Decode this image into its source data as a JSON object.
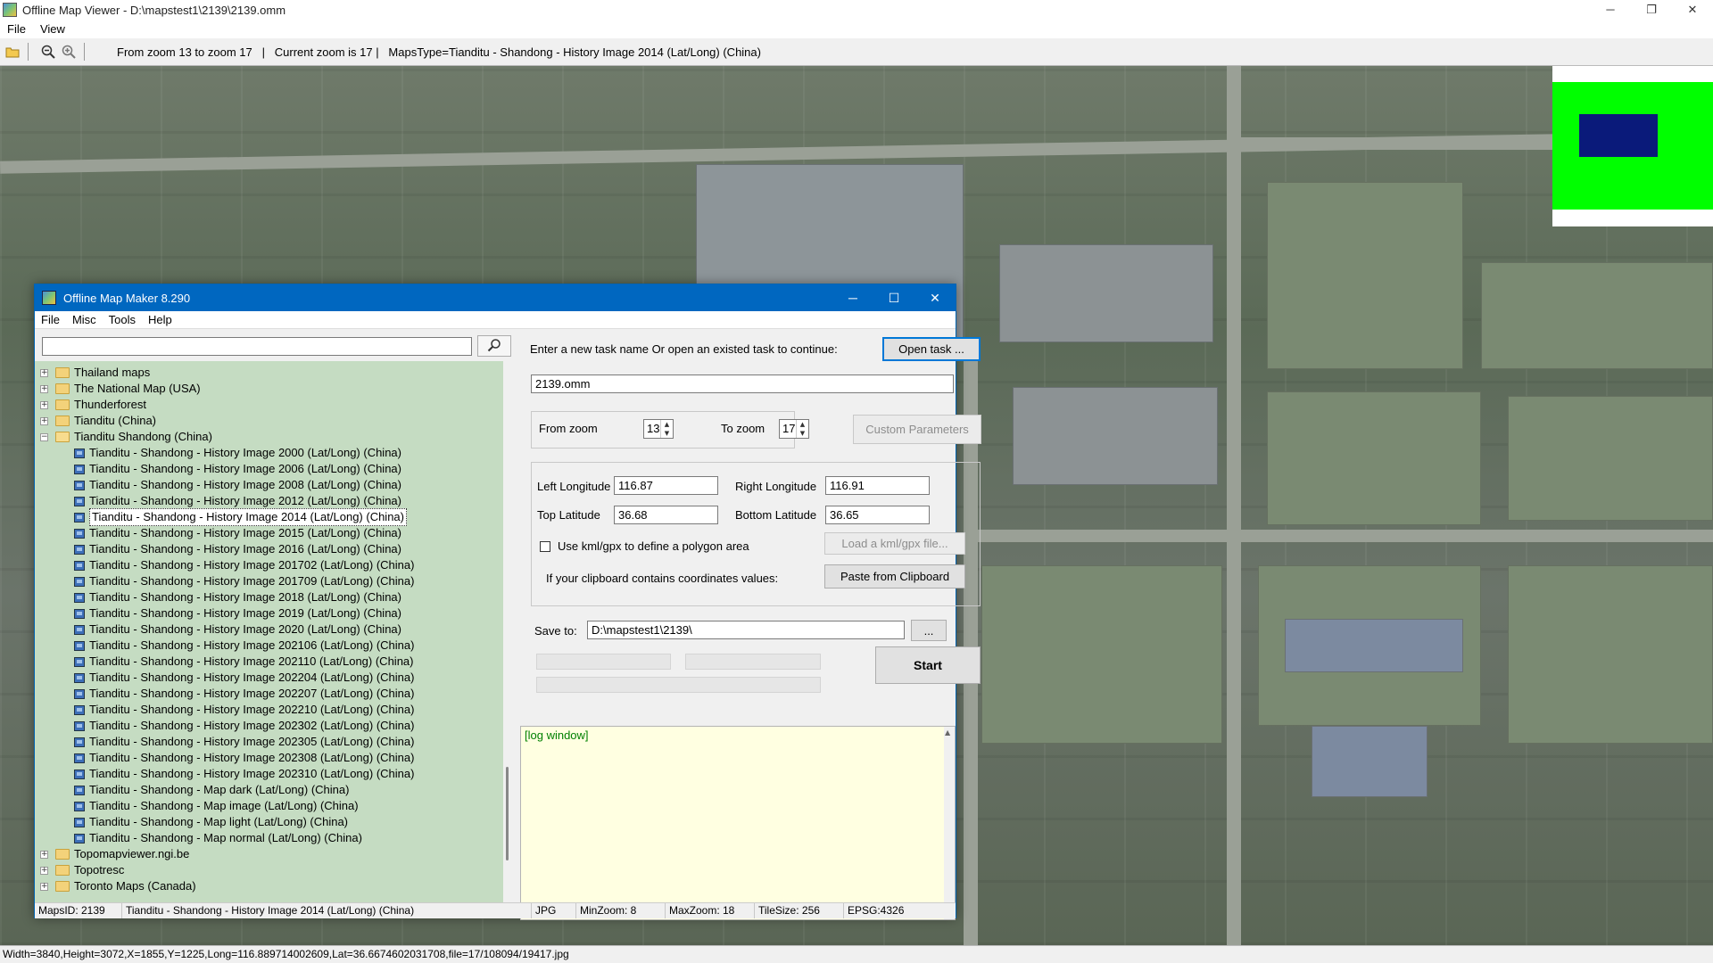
{
  "window": {
    "title": "Offline Map Viewer - D:\\mapstest1\\2139\\2139.omm",
    "controls": {
      "minimize": "─",
      "maximize": "❐",
      "close": "✕"
    }
  },
  "menu": {
    "items": [
      "File",
      "View"
    ]
  },
  "toolbar": {
    "info": "From zoom 13 to zoom 17   |   Current zoom is 17 |   MapsType=Tianditu - Shandong - History Image 2014 (Lat/Long) (China)"
  },
  "statusbar": {
    "text": "Width=3840,Height=3072,X=1855,Y=1225,Long=116.889714002609,Lat=36.6674602031708,file=17/108094/19417.jpg"
  },
  "dialog": {
    "title": "Offline Map Maker 8.290",
    "controls": {
      "minimize": "─",
      "maximize": "☐",
      "close": "✕"
    },
    "menu": [
      "File",
      "Misc",
      "Tools",
      "Help"
    ],
    "search": {
      "value": "",
      "placeholder": ""
    },
    "tree": [
      {
        "label": "Thailand maps",
        "type": "folder",
        "expanded": false,
        "level": 0
      },
      {
        "label": "The National Map (USA)",
        "type": "folder",
        "expanded": false,
        "level": 0
      },
      {
        "label": "Thunderforest",
        "type": "folder",
        "expanded": false,
        "level": 0
      },
      {
        "label": "Tianditu (China)",
        "type": "folder",
        "expanded": false,
        "level": 0
      },
      {
        "label": "Tianditu Shandong (China)",
        "type": "folder",
        "expanded": true,
        "level": 0
      },
      {
        "label": "Tianditu - Shandong - History Image 2000 (Lat/Long) (China)",
        "type": "map",
        "level": 1
      },
      {
        "label": "Tianditu - Shandong - History Image 2006 (Lat/Long) (China)",
        "type": "map",
        "level": 1
      },
      {
        "label": "Tianditu - Shandong - History Image 2008 (Lat/Long) (China)",
        "type": "map",
        "level": 1
      },
      {
        "label": "Tianditu - Shandong - History Image 2012 (Lat/Long) (China)",
        "type": "map",
        "level": 1
      },
      {
        "label": "Tianditu - Shandong - History Image 2014 (Lat/Long) (China)",
        "type": "map",
        "level": 1,
        "selected": true
      },
      {
        "label": "Tianditu - Shandong - History Image 2015 (Lat/Long) (China)",
        "type": "map",
        "level": 1
      },
      {
        "label": "Tianditu - Shandong - History Image 2016 (Lat/Long) (China)",
        "type": "map",
        "level": 1
      },
      {
        "label": "Tianditu - Shandong - History Image 201702 (Lat/Long) (China)",
        "type": "map",
        "level": 1
      },
      {
        "label": "Tianditu - Shandong - History Image 201709 (Lat/Long) (China)",
        "type": "map",
        "level": 1
      },
      {
        "label": "Tianditu - Shandong - History Image 2018 (Lat/Long) (China)",
        "type": "map",
        "level": 1
      },
      {
        "label": "Tianditu - Shandong - History Image 2019 (Lat/Long) (China)",
        "type": "map",
        "level": 1
      },
      {
        "label": "Tianditu - Shandong - History Image 2020 (Lat/Long) (China)",
        "type": "map",
        "level": 1
      },
      {
        "label": "Tianditu - Shandong - History Image 202106 (Lat/Long) (China)",
        "type": "map",
        "level": 1
      },
      {
        "label": "Tianditu - Shandong - History Image 202110 (Lat/Long) (China)",
        "type": "map",
        "level": 1
      },
      {
        "label": "Tianditu - Shandong - History Image 202204 (Lat/Long) (China)",
        "type": "map",
        "level": 1
      },
      {
        "label": "Tianditu - Shandong - History Image 202207 (Lat/Long) (China)",
        "type": "map",
        "level": 1
      },
      {
        "label": "Tianditu - Shandong - History Image 202210 (Lat/Long) (China)",
        "type": "map",
        "level": 1
      },
      {
        "label": "Tianditu - Shandong - History Image 202302 (Lat/Long) (China)",
        "type": "map",
        "level": 1
      },
      {
        "label": "Tianditu - Shandong - History Image 202305 (Lat/Long) (China)",
        "type": "map",
        "level": 1
      },
      {
        "label": "Tianditu - Shandong - History Image 202308 (Lat/Long) (China)",
        "type": "map",
        "level": 1
      },
      {
        "label": "Tianditu - Shandong - History Image 202310 (Lat/Long) (China)",
        "type": "map",
        "level": 1
      },
      {
        "label": "Tianditu - Shandong - Map dark (Lat/Long) (China)",
        "type": "map",
        "level": 1
      },
      {
        "label": "Tianditu - Shandong - Map image (Lat/Long) (China)",
        "type": "map",
        "level": 1
      },
      {
        "label": "Tianditu - Shandong - Map light (Lat/Long) (China)",
        "type": "map",
        "level": 1
      },
      {
        "label": "Tianditu - Shandong - Map normal (Lat/Long) (China)",
        "type": "map",
        "level": 1
      },
      {
        "label": "Topomapviewer.ngi.be",
        "type": "folder",
        "expanded": false,
        "level": 0
      },
      {
        "label": "Topotresc",
        "type": "folder",
        "expanded": false,
        "level": 0
      },
      {
        "label": "Toronto Maps (Canada)",
        "type": "folder",
        "expanded": false,
        "level": 0
      }
    ],
    "task": {
      "prompt": "Enter a new task name Or open an existed task to continue:",
      "open_button": "Open task ...",
      "name": "2139.omm"
    },
    "zoom": {
      "from_label": "From zoom",
      "from_value": "13",
      "to_label": "To zoom",
      "to_value": "17",
      "custom_button": "Custom Parameters"
    },
    "coords": {
      "left_label": "Left Longitude",
      "left_value": "116.87",
      "right_label": "Right Longitude",
      "right_value": "116.91",
      "top_label": "Top Latitude",
      "top_value": "36.68",
      "bottom_label": "Bottom Latitude",
      "bottom_value": "36.65",
      "kml_label": "Use kml/gpx to define a polygon area",
      "kml_checked": false,
      "kml_button": "Load a kml/gpx file...",
      "clipboard_label": "If your clipboard contains coordinates values:",
      "clipboard_button": "Paste from Clipboard"
    },
    "save": {
      "label": "Save to:",
      "path": "D:\\mapstest1\\2139\\",
      "browse_button": "...",
      "start_button": "Start"
    },
    "log": {
      "text": "[log window]"
    },
    "status": {
      "maps_id": "MapsID: 2139",
      "maps_name": "Tianditu - Shandong - History Image 2014 (Lat/Long) (China)",
      "format": "JPG",
      "min_zoom": "MinZoom: 8",
      "max_zoom": "MaxZoom: 18",
      "tile_size": "TileSize: 256",
      "epsg": "EPSG:4326"
    }
  }
}
